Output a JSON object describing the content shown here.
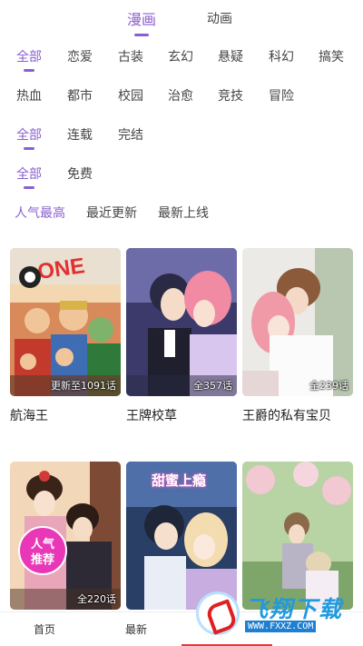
{
  "top_tabs": {
    "manga": "漫画",
    "anime": "动画"
  },
  "genres": [
    "全部",
    "恋爱",
    "古装",
    "玄幻",
    "悬疑",
    "科幻",
    "搞笑",
    "热血",
    "都市",
    "校园",
    "治愈",
    "竞技",
    "冒险"
  ],
  "status_filters": [
    "全部",
    "连载",
    "完结"
  ],
  "price_filters": [
    "全部",
    "免费"
  ],
  "sort_options": [
    "人气最高",
    "最近更新",
    "最新上线"
  ],
  "comics": [
    {
      "title": "航海王",
      "episodes": "更新至1091话"
    },
    {
      "title": "王牌校草",
      "episodes": "全357话"
    },
    {
      "title": "王爵的私有宝贝",
      "episodes": "全239话"
    },
    {
      "title": "",
      "episodes": "全220话",
      "badge": "人气推荐"
    },
    {
      "title": "",
      "episodes": "",
      "cover_text": "甜蜜上瘾"
    },
    {
      "title": "",
      "episodes": ""
    }
  ],
  "bottom_nav": {
    "home": "首页",
    "latest": "最新"
  },
  "watermark": {
    "text": "飞翔下载",
    "url": "WWW.FXXZ.COM"
  },
  "colors": {
    "accent": "#8a5fd0",
    "badge": "#e838b8",
    "nav_indicator": "#e43a3a"
  }
}
